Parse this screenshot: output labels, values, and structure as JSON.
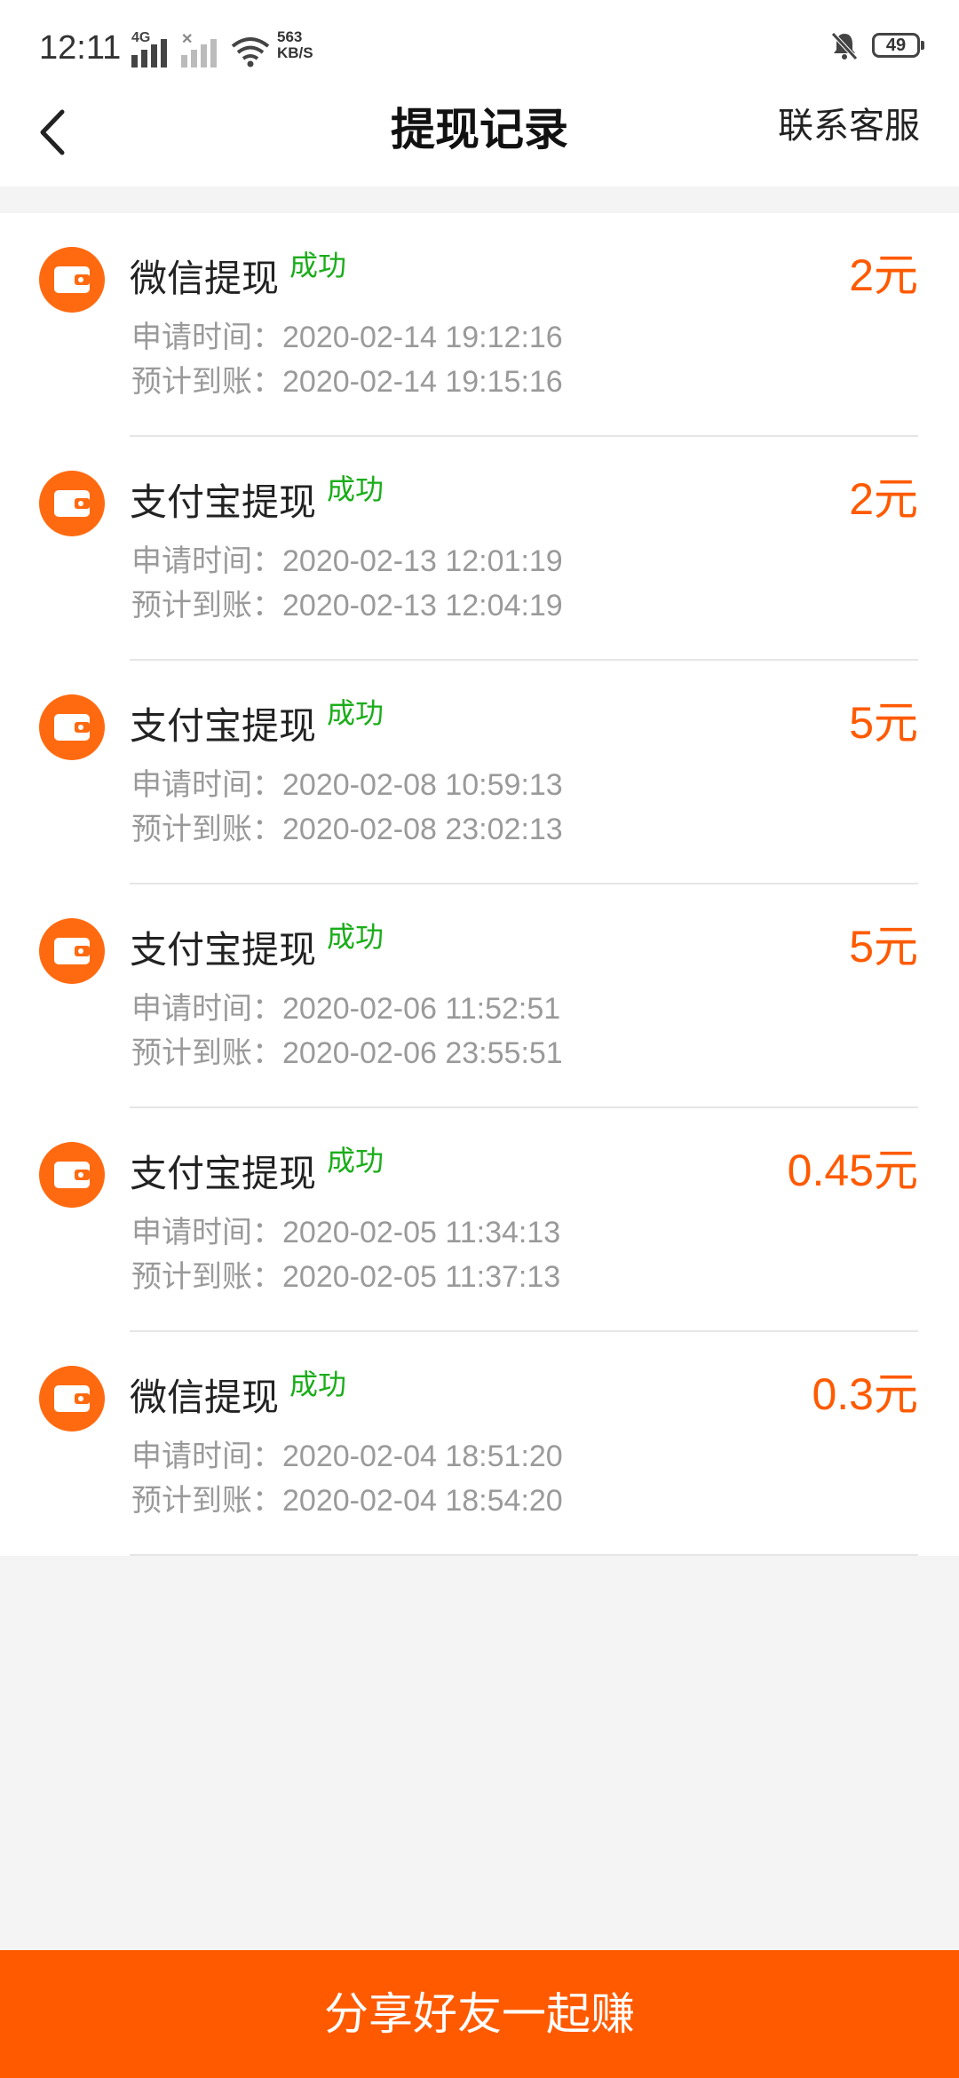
{
  "status_bar": {
    "time": "12:11",
    "network_label": "4G",
    "speed_value": "563",
    "speed_unit": "KB/S",
    "battery": "49"
  },
  "header": {
    "title": "提现记录",
    "contact_label": "联系客服"
  },
  "records": [
    {
      "title": "微信提现",
      "status": "成功",
      "amount": "2元",
      "apply_label": "申请时间：",
      "apply_time": "2020-02-14 19:12:16",
      "expect_label": "预计到账：",
      "expect_time": "2020-02-14 19:15:16"
    },
    {
      "title": "支付宝提现",
      "status": "成功",
      "amount": "2元",
      "apply_label": "申请时间：",
      "apply_time": "2020-02-13 12:01:19",
      "expect_label": "预计到账：",
      "expect_time": "2020-02-13 12:04:19"
    },
    {
      "title": "支付宝提现",
      "status": "成功",
      "amount": "5元",
      "apply_label": "申请时间：",
      "apply_time": "2020-02-08 10:59:13",
      "expect_label": "预计到账：",
      "expect_time": "2020-02-08 23:02:13"
    },
    {
      "title": "支付宝提现",
      "status": "成功",
      "amount": "5元",
      "apply_label": "申请时间：",
      "apply_time": "2020-02-06 11:52:51",
      "expect_label": "预计到账：",
      "expect_time": "2020-02-06 23:55:51"
    },
    {
      "title": "支付宝提现",
      "status": "成功",
      "amount": "0.45元",
      "apply_label": "申请时间：",
      "apply_time": "2020-02-05 11:34:13",
      "expect_label": "预计到账：",
      "expect_time": "2020-02-05 11:37:13"
    },
    {
      "title": "微信提现",
      "status": "成功",
      "amount": "0.3元",
      "apply_label": "申请时间：",
      "apply_time": "2020-02-04 18:51:20",
      "expect_label": "预计到账：",
      "expect_time": "2020-02-04 18:54:20"
    }
  ],
  "footer": {
    "share_label": "分享好友一起赚"
  },
  "colors": {
    "accent": "#ff5a00",
    "success": "#1aad19",
    "secondary_text": "#9a9a9a"
  }
}
